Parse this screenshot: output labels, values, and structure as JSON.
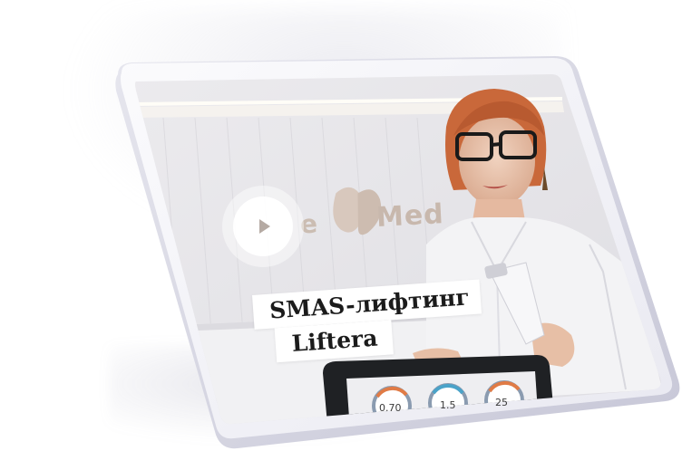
{
  "caption": {
    "line1": "SMAS-лифтинг",
    "line2": "Liftera"
  },
  "logo": {
    "text": "Med",
    "prefix": "e"
  },
  "device_panel": {
    "gauges": [
      "0.70",
      "1.5",
      "25"
    ]
  },
  "colors": {
    "tablet_frame": "#f4f4f8",
    "tablet_edge": "#d9d9e6",
    "screen_bg": "#e7e6ea",
    "play_circle": "#ffffff",
    "play_triangle": "#b5aaa3",
    "coat": "#f3f3f5",
    "hair": "#c9683a",
    "device_dark": "#1f2124",
    "caption_bg": "#ffffff",
    "caption_text": "#1b1b1b"
  },
  "icons": {
    "play": "play-icon",
    "logo_mark": "butterfly-logo-icon"
  }
}
